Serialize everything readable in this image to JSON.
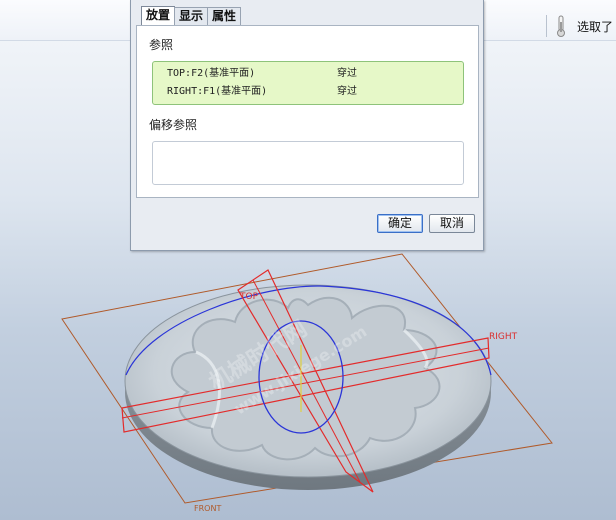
{
  "dialog": {
    "tabs": [
      "放置",
      "显示",
      "属性"
    ],
    "active_tab": 0,
    "references_label": "参照",
    "references": [
      {
        "name": "TOP:F2(基准平面)",
        "type": "穿过"
      },
      {
        "name": "RIGHT:F1(基准平面)",
        "type": "穿过"
      }
    ],
    "offset_label": "偏移参照",
    "ok_label": "确定",
    "cancel_label": "取消"
  },
  "toolbar": {
    "pick_label": "选取了"
  },
  "viewport": {
    "datum_planes": [
      "TOP",
      "RIGHT",
      "FRONT"
    ],
    "watermark": [
      "机械时代网",
      "www.jixiege.com"
    ],
    "colors": {
      "datum_plane": "#b05a2a",
      "selected_plane": "#e32b2b",
      "circle": "#2a35d8",
      "part": "#c8d0d6"
    }
  }
}
